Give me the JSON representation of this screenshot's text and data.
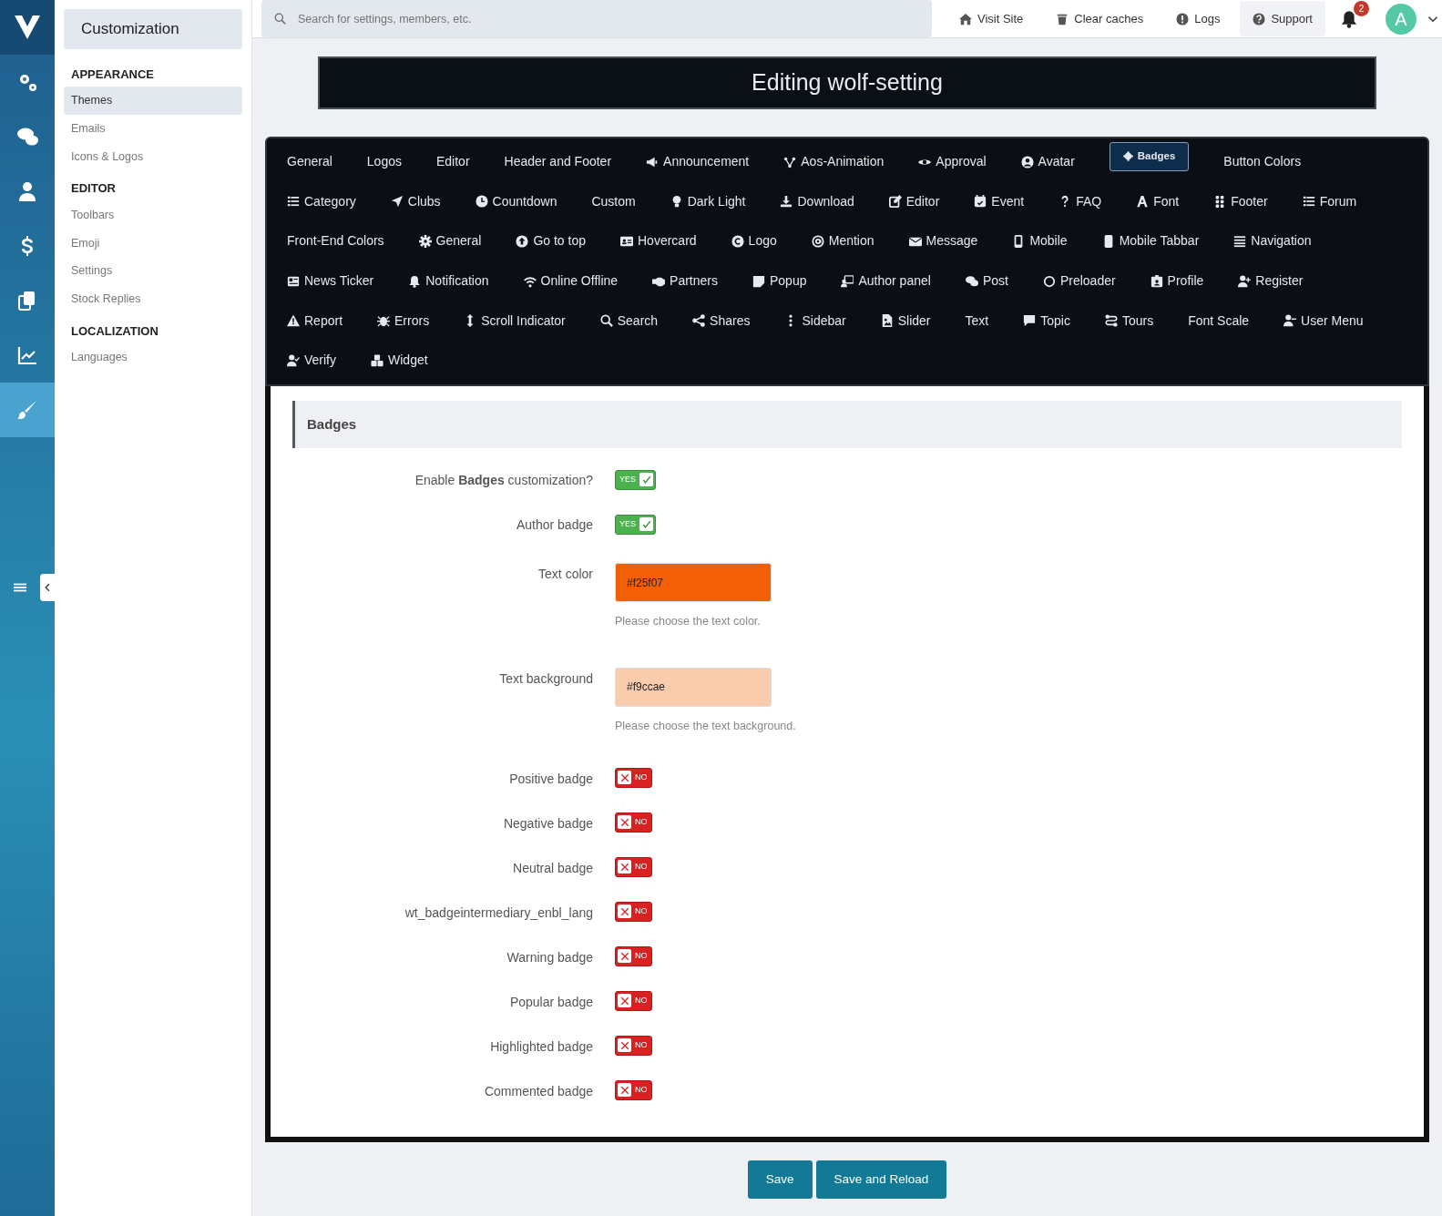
{
  "topbar": {
    "search": {
      "placeholder": "Search for settings, members, etc."
    },
    "links": [
      {
        "label": "Visit Site",
        "selected": false
      },
      {
        "label": "Clear caches",
        "selected": false
      },
      {
        "label": "Logs",
        "selected": false
      },
      {
        "label": "Support",
        "selected": true
      }
    ],
    "notifications": "2",
    "avatar": "A"
  },
  "nav": {
    "items": [
      {
        "selected": false
      },
      {
        "selected": false
      },
      {
        "selected": false
      },
      {
        "selected": false
      },
      {
        "selected": false
      },
      {
        "selected": false
      },
      {
        "selected": true
      }
    ]
  },
  "sidebar": {
    "title": "Customization",
    "sections": [
      {
        "heading": "APPEARANCE",
        "items": [
          {
            "label": "Themes",
            "selected": true
          },
          {
            "label": "Emails",
            "selected": false
          },
          {
            "label": "Icons & Logos",
            "selected": false
          }
        ]
      },
      {
        "heading": "EDITOR",
        "items": [
          {
            "label": "Toolbars",
            "selected": false
          },
          {
            "label": "Emoji",
            "selected": false
          },
          {
            "label": "Settings",
            "selected": false
          },
          {
            "label": "Stock Replies",
            "selected": false
          }
        ]
      },
      {
        "heading": "LOCALIZATION",
        "items": [
          {
            "label": "Languages",
            "selected": false
          }
        ]
      }
    ]
  },
  "page_title": "Editing wolf-setting",
  "tab_rows": [
    [
      {
        "label": "General",
        "selected": false
      },
      {
        "label": "Logos",
        "selected": false
      },
      {
        "label": "Editor",
        "selected": false
      },
      {
        "label": "Header and Footer",
        "selected": false
      },
      {
        "label": "Announcement",
        "selected": false
      },
      {
        "label": "Aos-Animation",
        "selected": false
      },
      {
        "label": "Approval",
        "selected": false
      },
      {
        "label": "Avatar",
        "selected": false
      },
      {
        "label": "Badges",
        "selected": true
      },
      {
        "label": "Button Colors",
        "selected": false
      }
    ],
    [
      {
        "label": "Category",
        "selected": false
      },
      {
        "label": "Clubs",
        "selected": false
      },
      {
        "label": "Countdown",
        "selected": false
      },
      {
        "label": "Custom",
        "selected": false
      },
      {
        "label": "Dark Light",
        "selected": false
      },
      {
        "label": "Download",
        "selected": false
      },
      {
        "label": "Editor",
        "selected": false
      },
      {
        "label": "Event",
        "selected": false
      },
      {
        "label": "FAQ",
        "selected": false
      },
      {
        "label": "Font",
        "selected": false
      },
      {
        "label": "Footer",
        "selected": false
      },
      {
        "label": "Forum",
        "selected": false
      }
    ],
    [
      {
        "label": "Front-End Colors",
        "selected": false
      },
      {
        "label": "General",
        "selected": false
      },
      {
        "label": "Go to top",
        "selected": false
      },
      {
        "label": "Hovercard",
        "selected": false
      },
      {
        "label": "Logo",
        "selected": false
      },
      {
        "label": "Mention",
        "selected": false
      },
      {
        "label": "Message",
        "selected": false
      },
      {
        "label": "Mobile",
        "selected": false
      },
      {
        "label": "Mobile Tabbar",
        "selected": false
      },
      {
        "label": "Navigation",
        "selected": false
      }
    ],
    [
      {
        "label": "News Ticker",
        "selected": false
      },
      {
        "label": "Notification",
        "selected": false
      },
      {
        "label": "Online Offline",
        "selected": false
      },
      {
        "label": "Partners",
        "selected": false
      },
      {
        "label": "Popup",
        "selected": false
      },
      {
        "label": "Author panel",
        "selected": false
      },
      {
        "label": "Post",
        "selected": false
      },
      {
        "label": "Preloader",
        "selected": false
      },
      {
        "label": "Profile",
        "selected": false
      },
      {
        "label": "Register",
        "selected": false
      }
    ],
    [
      {
        "label": "Report",
        "selected": false
      },
      {
        "label": "Errors",
        "selected": false
      },
      {
        "label": "Scroll Indicator",
        "selected": false
      },
      {
        "label": "Search",
        "selected": false
      },
      {
        "label": "Shares",
        "selected": false
      },
      {
        "label": "Sidebar",
        "selected": false
      },
      {
        "label": "Slider",
        "selected": false
      },
      {
        "label": "Text",
        "selected": false
      },
      {
        "label": "Topic",
        "selected": false
      },
      {
        "label": "Tours",
        "selected": false
      },
      {
        "label": "Font Scale",
        "selected": false
      },
      {
        "label": "User Menu",
        "selected": false
      }
    ],
    [
      {
        "label": "Verify",
        "selected": false
      },
      {
        "label": "Widget",
        "selected": false
      }
    ]
  ],
  "form": {
    "heading": "Badges",
    "rows": [
      {
        "kind": "switch",
        "label": "Enable **Badges** customization?",
        "checked": true,
        "switch_text": "YES"
      },
      {
        "kind": "switch",
        "label": "Author badge",
        "checked": true,
        "switch_text": "YES"
      },
      {
        "kind": "color",
        "label": "Text color",
        "value": "#f25f07",
        "color": "#f25f07",
        "hint": "Please choose the text color."
      },
      {
        "kind": "color",
        "label": "Text background",
        "value": "#f9ccae",
        "color": "#f9ccae",
        "hint": "Please choose the text background."
      },
      {
        "kind": "switch",
        "label": "Positive badge",
        "checked": false,
        "switch_text": "NO"
      },
      {
        "kind": "switch",
        "label": "Negative badge",
        "checked": false,
        "switch_text": "NO"
      },
      {
        "kind": "switch",
        "label": "Neutral badge",
        "checked": false,
        "switch_text": "NO"
      },
      {
        "kind": "switch",
        "label": "wt_badgeintermediary_enbl_lang",
        "checked": false,
        "switch_text": "NO"
      },
      {
        "kind": "switch",
        "label": "Warning badge",
        "checked": false,
        "switch_text": "NO"
      },
      {
        "kind": "switch",
        "label": "Popular badge",
        "checked": false,
        "switch_text": "NO"
      },
      {
        "kind": "switch",
        "label": "Highlighted badge",
        "checked": false,
        "switch_text": "NO"
      },
      {
        "kind": "switch",
        "label": "Commented badge",
        "checked": false,
        "switch_text": "NO"
      }
    ]
  },
  "buttons": [
    "Save",
    "Save and Reload"
  ]
}
